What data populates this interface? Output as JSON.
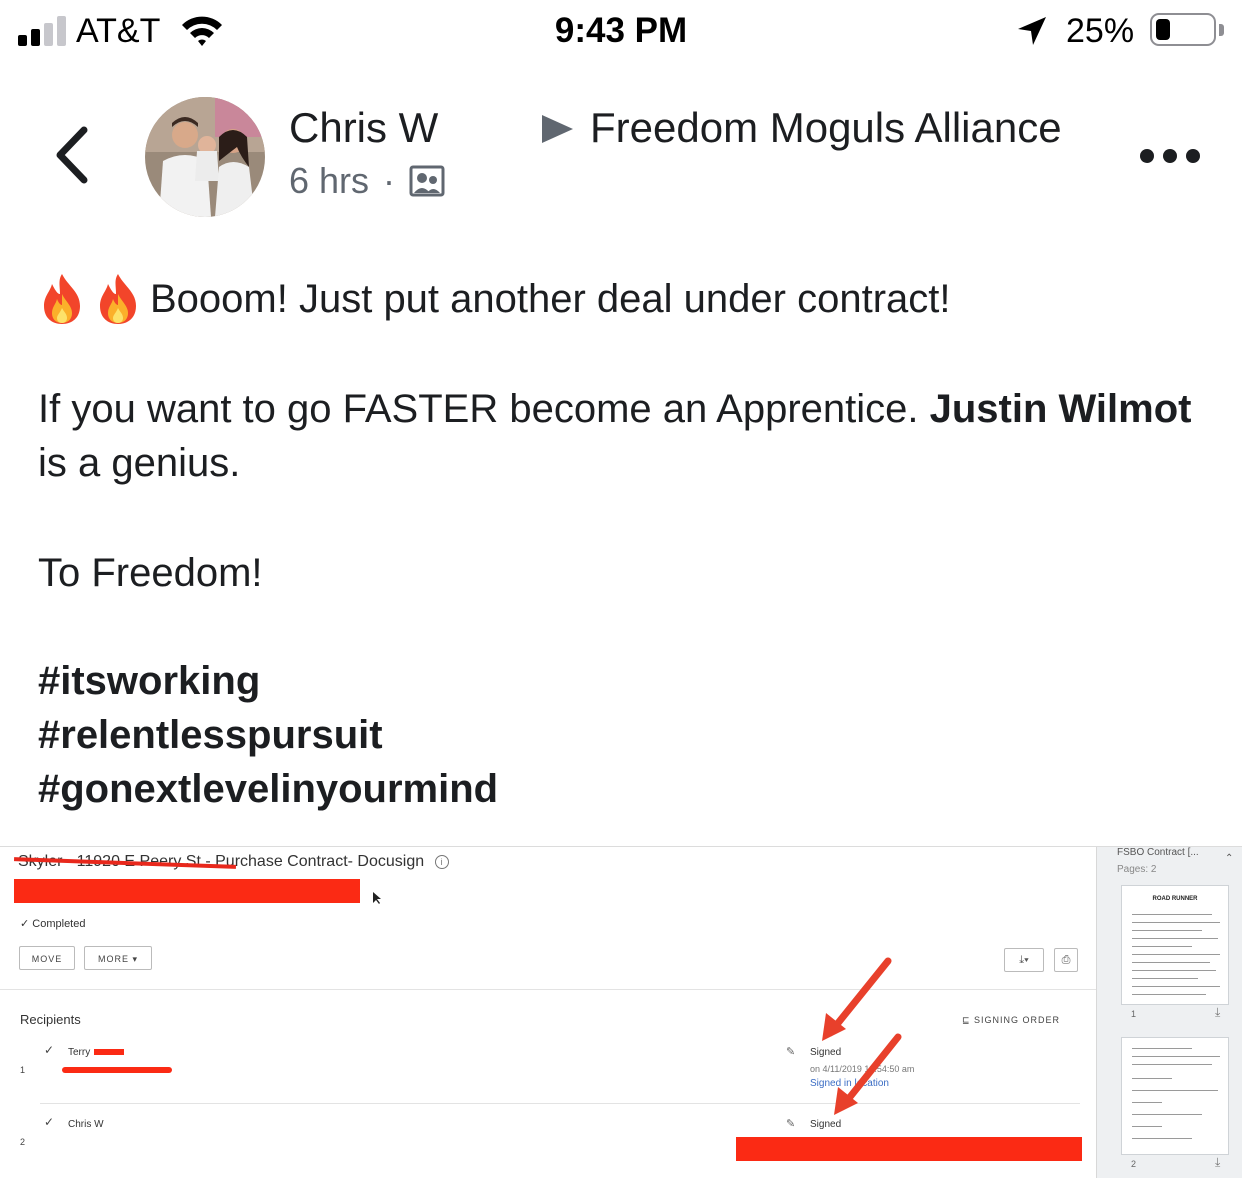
{
  "status_bar": {
    "carrier": "AT&T",
    "time": "9:43 PM",
    "battery_percent": "25%",
    "battery_level": 0.25,
    "icons": [
      "signal-icon",
      "wifi-icon",
      "location-arrow-icon",
      "battery-icon"
    ]
  },
  "post": {
    "author": "Chris W",
    "time_ago": "6 hrs",
    "separator": "·",
    "group": "Freedom Moguls Alliance",
    "icons": [
      "back-chevron-icon",
      "group-privacy-icon",
      "triangle-arrow-icon",
      "more-dots-icon",
      "fire-emoji-icon"
    ],
    "line1": "Booom! Just put another deal under contract!",
    "line2_prefix": "If you want to go FASTER become an Apprentice. ",
    "line2_bold": "Justin Wilmot",
    "line2_suffix": " is a genius.",
    "line3": "To Freedom!",
    "hashtags": [
      "#itsworking",
      "#relentlesspursuit",
      "#gonextlevelinyourmind"
    ]
  },
  "attachment": {
    "title_struck": "Skyler - 11920 E Peery St",
    "title": "- Purchase Contract- Docusign",
    "info_icon": "i",
    "status": "Completed",
    "move_label": "MOVE",
    "more_label": "MORE",
    "recipients_label": "Recipients",
    "signing_order_label": "SIGNING ORDER",
    "recipients": [
      {
        "num": "1",
        "name": "Terry",
        "status": "Signed",
        "signed_on": "on 4/11/2019 10:54:50 am",
        "signed_location": "Signed in location"
      },
      {
        "num": "2",
        "name": "Chris W",
        "status": "Signed"
      }
    ],
    "sidebar": {
      "title": "FSBO Contract [...",
      "pages": "Pages: 2",
      "thumb_heading": "ROAD RUNNER",
      "page_labels": [
        "1",
        "2"
      ]
    },
    "colors": {
      "redaction": "#fb2a14",
      "link": "#3b6dc4"
    }
  }
}
